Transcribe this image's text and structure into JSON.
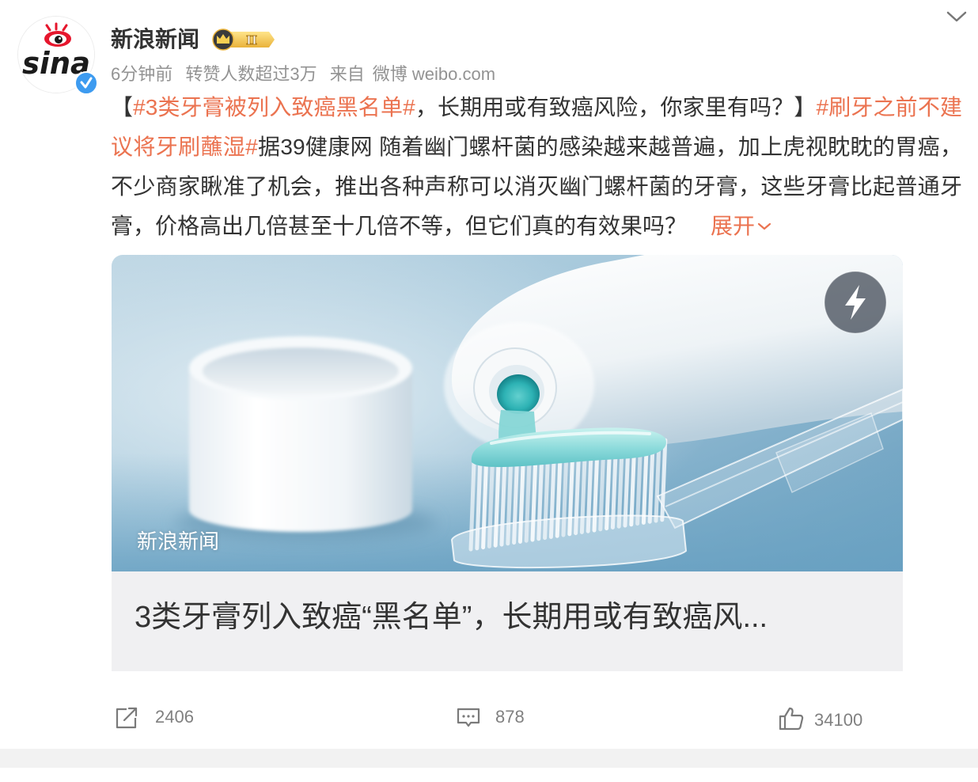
{
  "post": {
    "author": {
      "name": "新浪新闻",
      "level_badge": "II",
      "avatar_logo_text": "sina",
      "verified": true
    },
    "meta": {
      "time": "6分钟前",
      "hot_label": "转赞人数超过3万",
      "source_prefix": "来自",
      "source": "微博 weibo.com"
    },
    "text_lines": [
      [
        {
          "text": "【",
          "topic": false
        },
        {
          "text": "#3类牙膏被列入致癌黑名单#",
          "topic": true
        },
        {
          "text": "，长期用或有致癌风险，你家里有吗？】",
          "topic": false
        },
        {
          "text": "#刷牙之前不建",
          "topic": true
        }
      ],
      [
        {
          "text": "议将牙刷蘸湿#",
          "topic": true
        },
        {
          "text": "据39健康网 随着幽门螺杆菌的感染越来越普遍，加上虎视眈眈的胃癌，",
          "topic": false
        }
      ],
      [
        {
          "text": "不少商家瞅准了机会，推出各种声称可以消灭幽门螺杆菌的牙膏，这些牙膏比起普通牙",
          "topic": false
        }
      ],
      [
        {
          "text": "膏，价格高出几倍甚至十几倍不等，但它们真的有效果吗？",
          "topic": false
        }
      ]
    ],
    "expand_label": "展开",
    "link_card": {
      "image_caption": "新浪新闻",
      "title": "3类牙膏列入致癌“黑名单”，长期用或有致癌风..."
    },
    "actions": {
      "repost_count": "2406",
      "comment_count": "878",
      "like_count": "34100"
    }
  },
  "icons": {
    "avatar": "sina-logo-icon",
    "verified": "verified-icon",
    "level": "crown-badge-icon",
    "more": "chevron-down-icon",
    "expand": "chevron-down-icon",
    "card_action": "lightning-icon",
    "repost": "share-icon",
    "comment": "comment-icon",
    "like": "thumbs-up-icon"
  },
  "colors": {
    "text": "#333333",
    "meta": "#939393",
    "topic": "#eb7350",
    "verified": "#3d9bf0",
    "card_title_bg": "#f0f0f2",
    "badge_gold": "#f2c94c",
    "sina_red": "#e6162d",
    "action_gray": "#808080"
  }
}
